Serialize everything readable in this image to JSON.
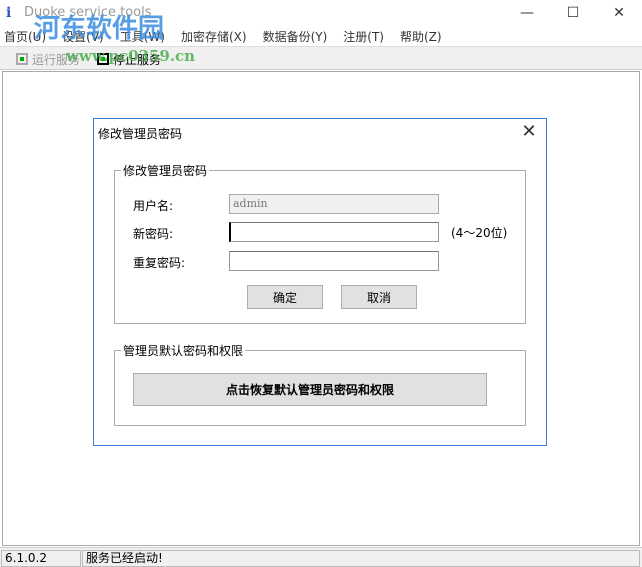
{
  "window": {
    "title": "Duoke service tools",
    "minimize": "—",
    "maximize": "☐",
    "close": "✕"
  },
  "watermark": {
    "name": "河东软件园",
    "url": "www.pc0359.cn"
  },
  "menu": [
    "首页(U)",
    "设置(V)",
    "工具(W)",
    "加密存储(X)",
    "数据备份(Y)",
    "注册(T)",
    "帮助(Z)"
  ],
  "toolbar": {
    "run_service": "运行服务",
    "stop_service": "停止服务"
  },
  "dialog": {
    "title": "修改管理员密码",
    "close": "✕",
    "group1": {
      "title": "修改管理员密码",
      "username_label": "用户名:",
      "username_value": "admin",
      "new_password_label": "新密码:",
      "new_password_value": "",
      "hint": "(4～20位)",
      "repeat_password_label": "重复密码:",
      "repeat_password_value": "",
      "ok": "确定",
      "cancel": "取消"
    },
    "group2": {
      "title": "管理员默认密码和权限",
      "restore_button": "点击恢复默认管理员密码和权限"
    }
  },
  "status": {
    "version": "6.1.0.2",
    "message": "服务已经启动!"
  }
}
